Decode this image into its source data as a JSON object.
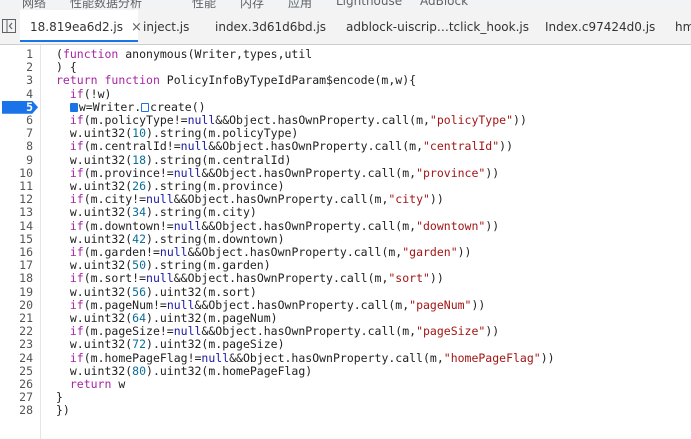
{
  "top_menu": [
    "网络",
    "性能数据分析",
    "性能",
    "内存",
    "应用",
    "Lighthouse",
    "AdBlock"
  ],
  "tabs": [
    {
      "label": "18.819ea6d2.js",
      "active": true,
      "close": "×"
    },
    {
      "label": "inject.js",
      "active": false
    },
    {
      "label": "index.3d61d6bd.js",
      "active": false
    },
    {
      "label": "adblock-uiscrip…tclick_hook.js",
      "active": false
    },
    {
      "label": "Index.c97424d0.js",
      "active": false
    },
    {
      "label": "hm",
      "active": false
    }
  ],
  "editor": {
    "breakpoint_line": 5,
    "line_numbers": [
      "1",
      "2",
      "3",
      "4",
      "5",
      "6",
      "7",
      "8",
      "9",
      "10",
      "11",
      "12",
      "13",
      "14",
      "15",
      "16",
      "17",
      "18",
      "19",
      "20",
      "21",
      "22",
      "23",
      "24",
      "25",
      "26",
      "27",
      "28"
    ],
    "lines": [
      "(function anonymous(Writer,types,util",
      ") {",
      "return function PolicyInfoByTypeIdParam$encode(m,w){",
      "  if(!w)",
      "  w=Writer.create()",
      "  if(m.policyType!=null&&Object.hasOwnProperty.call(m,\"policyType\"))",
      "  w.uint32(10).string(m.policyType)",
      "  if(m.centralId!=null&&Object.hasOwnProperty.call(m,\"centralId\"))",
      "  w.uint32(18).string(m.centralId)",
      "  if(m.province!=null&&Object.hasOwnProperty.call(m,\"province\"))",
      "  w.uint32(26).string(m.province)",
      "  if(m.city!=null&&Object.hasOwnProperty.call(m,\"city\"))",
      "  w.uint32(34).string(m.city)",
      "  if(m.downtown!=null&&Object.hasOwnProperty.call(m,\"downtown\"))",
      "  w.uint32(42).string(m.downtown)",
      "  if(m.garden!=null&&Object.hasOwnProperty.call(m,\"garden\"))",
      "  w.uint32(50).string(m.garden)",
      "  if(m.sort!=null&&Object.hasOwnProperty.call(m,\"sort\"))",
      "  w.uint32(56).uint32(m.sort)",
      "  if(m.pageNum!=null&&Object.hasOwnProperty.call(m,\"pageNum\"))",
      "  w.uint32(64).uint32(m.pageNum)",
      "  if(m.pageSize!=null&&Object.hasOwnProperty.call(m,\"pageSize\"))",
      "  w.uint32(72).uint32(m.pageSize)",
      "  if(m.homePageFlag!=null&&Object.hasOwnProperty.call(m,\"homePageFlag\"))",
      "  w.uint32(80).uint32(m.homePageFlag)",
      "  return w",
      "}",
      "})"
    ]
  }
}
